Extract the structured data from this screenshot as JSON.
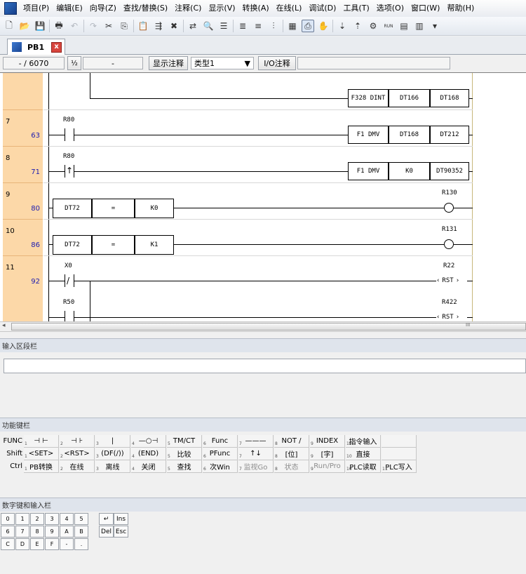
{
  "menu": [
    "项目(P)",
    "编辑(E)",
    "向导(Z)",
    "查找/替换(S)",
    "注释(C)",
    "显示(V)",
    "转换(A)",
    "在线(L)",
    "调试(D)",
    "工具(T)",
    "选项(O)",
    "窗口(W)",
    "帮助(H)"
  ],
  "toolbar": {
    "icons": [
      "new-file-icon",
      "open-folder-icon",
      "save-icon",
      "print-icon",
      "undo-icon",
      "redo-icon",
      "cut-icon",
      "copy-icon",
      "paste-icon",
      "insert-row-icon",
      "delete-row-icon",
      "replace-icon",
      "find-icon",
      "list-icon",
      "comment-icon",
      "monitor-icon",
      "data-icon",
      "block-icon",
      "program-icon",
      "pointer-icon",
      "download-icon",
      "upload-icon",
      "force-icon",
      "run-mode-icon",
      "run-icon",
      "settings-icon",
      "dropdown-icon"
    ],
    "glyphs": [
      "🗋",
      "📂",
      "💾",
      "🖶",
      "↶",
      "↷",
      "✂",
      "⎘",
      "📋",
      "⇶",
      "✖",
      "⇄",
      "🔍",
      "☰",
      "≣",
      "≡",
      "⫶",
      "▦",
      "⎙",
      "✋",
      "⇣",
      "⇡",
      "⚙",
      "RUN",
      "▤",
      "▥",
      "▾"
    ]
  },
  "tab": {
    "label": "PB1",
    "close": "x"
  },
  "infobar": {
    "position": "- /  6070",
    "toggle": "½",
    "field": "-",
    "comment_btn": "显示注释",
    "type_select": "类型1",
    "io_btn": "I/O注释"
  },
  "ladder": {
    "rows": [
      {
        "row": "",
        "step": ""
      },
      {
        "row": "7",
        "step": "63"
      },
      {
        "row": "8",
        "step": "71"
      },
      {
        "row": "9",
        "step": "80"
      },
      {
        "row": "10",
        "step": "86"
      },
      {
        "row": "11",
        "step": "92"
      }
    ],
    "r0": {
      "fn": "F328 DINT",
      "op1": "DT166",
      "op2": "DT168"
    },
    "r1": {
      "contact": "R80",
      "fn": "F1 DMV",
      "op1": "DT168",
      "op2": "DT212"
    },
    "r2": {
      "contact": "R80",
      "fn": "F1 DMV",
      "op1": "K0",
      "op2": "DT90352"
    },
    "r3": {
      "a": "DT72",
      "op": "=",
      "b": "K0",
      "coil": "R130"
    },
    "r4": {
      "a": "DT72",
      "op": "=",
      "b": "K1",
      "coil": "R131"
    },
    "r5": {
      "contact": "X0",
      "contact2": "R50",
      "coil": "R22",
      "coil2": "R422",
      "rst": "RST"
    }
  },
  "scroll_label": "III",
  "input_panel": {
    "title": "输入区段栏"
  },
  "fkeys": {
    "title": "功能键栏",
    "rows": [
      {
        "label": "FUNC",
        "keys": [
          "⊣ ⊢",
          "⊣ ⊦",
          "|",
          "—○⊣",
          "TM/CT",
          "Func",
          "———",
          "NOT /",
          "INDEX",
          "指令输入",
          ""
        ]
      },
      {
        "label": "Shift",
        "keys": [
          "<SET>",
          "<RST>",
          "(DF(/))",
          "(END)",
          "比较",
          "PFunc",
          "↑↓",
          "[位]",
          "[字]",
          "直接",
          ""
        ]
      },
      {
        "label": "Ctrl",
        "keys": [
          "PB转换",
          "在线",
          "离线",
          "关闭",
          "查找",
          "次Win",
          "监视Go",
          "状态",
          "Run/Pro",
          "PLC读取",
          "PLC写入"
        ]
      }
    ],
    "nums": [
      "1",
      "2",
      "3",
      "4",
      "5",
      "6",
      "7",
      "8",
      "9",
      "10",
      "11"
    ]
  },
  "numkeys": {
    "title": "数字键和输入栏",
    "rows": [
      [
        "0",
        "1",
        "2",
        "3",
        "4",
        "5"
      ],
      [
        "6",
        "7",
        "8",
        "9",
        "A",
        "B"
      ],
      [
        "C",
        "D",
        "E",
        "F",
        "-",
        "."
      ]
    ],
    "enter": "↵",
    "ins": "Ins",
    "del": "Del",
    "esc": "Esc"
  }
}
